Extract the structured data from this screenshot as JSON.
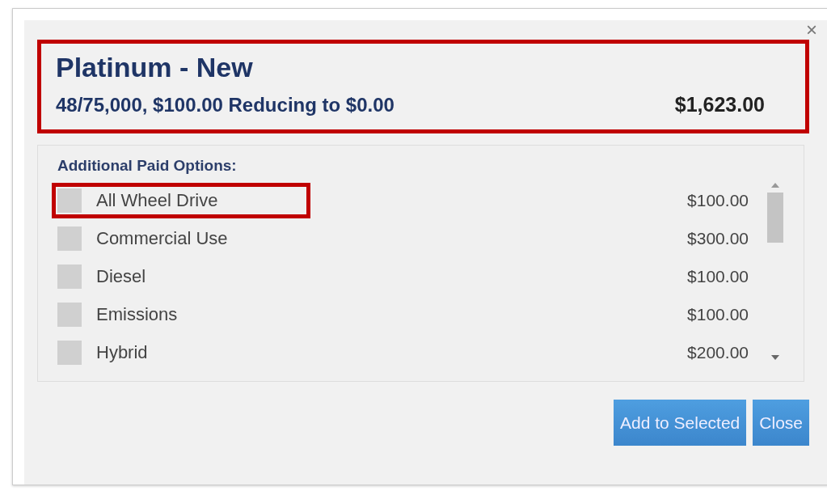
{
  "dialog": {
    "close_glyph": "×"
  },
  "plan": {
    "title": "Platinum - New",
    "terms": "48/75,000, $100.00 Reducing to $0.00",
    "price": "$1,623.00",
    "highlighted": true
  },
  "options": {
    "label": "Additional Paid Options:",
    "items": [
      {
        "name": "All Wheel Drive",
        "price": "$100.00",
        "checked": false,
        "highlighted": true
      },
      {
        "name": "Commercial Use",
        "price": "$300.00",
        "checked": false,
        "highlighted": false
      },
      {
        "name": "Diesel",
        "price": "$100.00",
        "checked": false,
        "highlighted": false
      },
      {
        "name": "Emissions",
        "price": "$100.00",
        "checked": false,
        "highlighted": false
      },
      {
        "name": "Hybrid",
        "price": "$200.00",
        "checked": false,
        "highlighted": false
      }
    ]
  },
  "buttons": [
    {
      "label": "Add to Selected"
    },
    {
      "label": "Close"
    }
  ]
}
